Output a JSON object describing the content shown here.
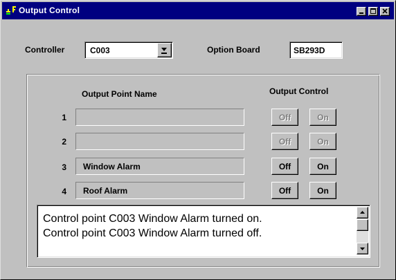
{
  "window": {
    "title": "Output Control"
  },
  "header": {
    "controller_label": "Controller",
    "controller_value": "C003",
    "option_board_label": "Option Board",
    "option_board_value": "SB293D"
  },
  "outputs": {
    "name_header": "Output Point Name",
    "control_header": "Output Control",
    "off_label": "Off",
    "on_label": "On",
    "rows": [
      {
        "num": "1",
        "name": "",
        "enabled": false
      },
      {
        "num": "2",
        "name": "",
        "enabled": false
      },
      {
        "num": "3",
        "name": "Window Alarm",
        "enabled": true
      },
      {
        "num": "4",
        "name": "Roof Alarm",
        "enabled": true
      }
    ]
  },
  "log": {
    "lines": [
      "Control point C003 Window Alarm turned on.",
      "Control point C003 Window Alarm turned off."
    ]
  },
  "icons": {
    "app": "app-icon",
    "minimize": "minimize-icon",
    "maximize": "maximize-icon",
    "close": "close-icon",
    "dropdown": "dropdown-arrow-icon",
    "scroll_up": "scroll-up-icon",
    "scroll_down": "scroll-down-icon"
  },
  "colors": {
    "titlebar": "#000080",
    "face": "#c0c0c0",
    "disabled_text": "#808080"
  }
}
